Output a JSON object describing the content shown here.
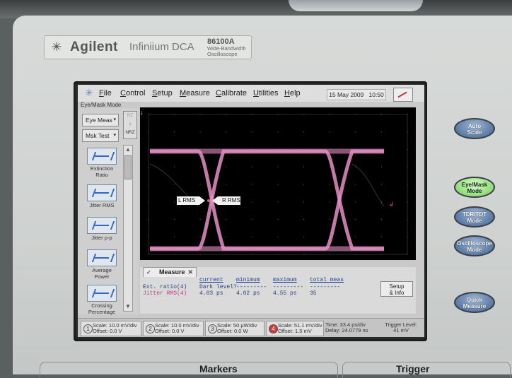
{
  "brand": {
    "name": "Agilent",
    "product": "Infiniium DCA",
    "model": "86100A",
    "description_line1": "Wide-Bandwidth",
    "description_line2": "Oscilloscope"
  },
  "menu": {
    "items": [
      "File",
      "Control",
      "Setup",
      "Measure",
      "Calibrate",
      "Utilities",
      "Help"
    ],
    "date": "15 May 2009",
    "time": "10:50"
  },
  "mode_label": "Eye/Mask Mode",
  "left_panel": {
    "eye_meas": "Eye Meas",
    "msk_test": "Msk Test",
    "rz": "RZ",
    "nrz": "NRZ",
    "measurements": [
      {
        "label_line1": "Extinction",
        "label_line2": "Ratio"
      },
      {
        "label_line1": "Jitter RMS",
        "label_line2": ""
      },
      {
        "label_line1": "Jitter p-p",
        "label_line2": ""
      },
      {
        "label_line1": "Average",
        "label_line2": "Power"
      },
      {
        "label_line1": "Crossing",
        "label_line2": "Percentage"
      }
    ]
  },
  "waveform": {
    "markers": {
      "left": "L RMS",
      "right": "R RMS"
    },
    "trace_color": "#e58fc4"
  },
  "measure_panel": {
    "tab": "Measure",
    "headers": [
      "current",
      "minimum",
      "maximum",
      "total meas"
    ],
    "rows": [
      {
        "name": "Ext. ratio(4)",
        "current": "Dark level?",
        "minimum": "---------",
        "maximum": "---------",
        "total": "---------"
      },
      {
        "name": "Jitter RMS(4)",
        "current": "4.03 ps",
        "minimum": "4.02 ps",
        "maximum": "4.55 ps",
        "total": "35"
      }
    ],
    "setup_line1": "Setup",
    "setup_line2": "& Info"
  },
  "status": {
    "channels": [
      {
        "num": "1",
        "scale": "Scale: 10.0 mV/div",
        "offset": "Offset: 0.0 V"
      },
      {
        "num": "2",
        "scale": "Scale: 10.0 mV/div",
        "offset": "Offset: 0.0 V"
      },
      {
        "num": "3",
        "scale": "Scale: 50 µW/div",
        "offset": "Offset: 0.0 W"
      },
      {
        "num": "4",
        "scale": "Scale: 51.1 mV/div",
        "offset": "Offset: 1.5 mV"
      }
    ],
    "time_line1": "Time: 33.4 ps/div",
    "time_line2": "Delay: 24.0779 ns",
    "trigger_line1": "Trigger Level:",
    "trigger_line2": "41 mV"
  },
  "hard_buttons": [
    {
      "line1": "Auto",
      "line2": "Scale"
    },
    {
      "line1": "Eye/Mask",
      "line2": "Mode"
    },
    {
      "line1": "TDR/TDT",
      "line2": "Mode"
    },
    {
      "line1": "Oscilloscope",
      "line2": "Mode"
    },
    {
      "line1": "Quick",
      "line2": "Measure"
    }
  ],
  "bottom": {
    "markers": "Markers",
    "trigger": "Trigger"
  }
}
